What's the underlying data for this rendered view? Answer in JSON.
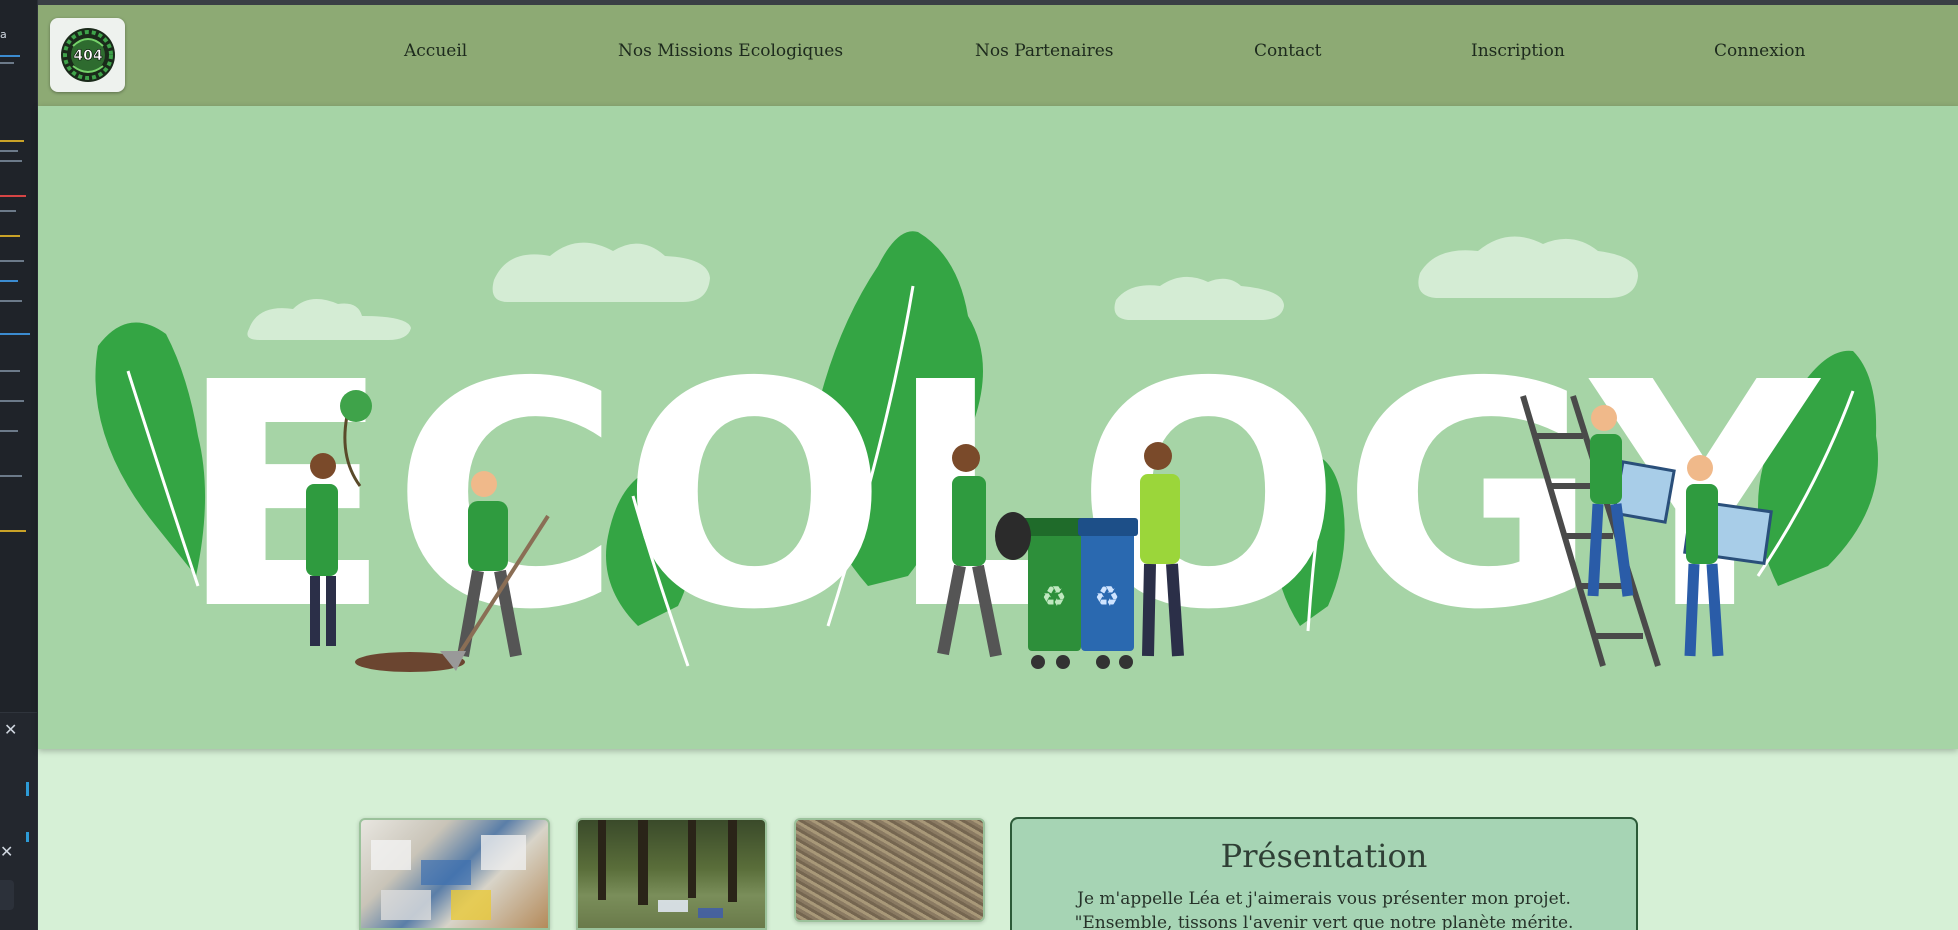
{
  "nav": {
    "logo_text": "404",
    "items": [
      {
        "label": "Accueil"
      },
      {
        "label": "Nos Missions Ecologiques"
      },
      {
        "label": "Nos Partenaires"
      },
      {
        "label": "Contact"
      },
      {
        "label": "Inscription"
      },
      {
        "label": "Connexion"
      }
    ]
  },
  "hero": {
    "word": "ECOLOGY"
  },
  "gallery": {
    "images": [
      {
        "name": "garbage-pile-image"
      },
      {
        "name": "forest-waste-image"
      },
      {
        "name": "cigarette-butts-image"
      }
    ]
  },
  "presentation": {
    "title": "Présentation",
    "line1": "Je m'appelle Léa et j'aimerais vous présenter mon projet.",
    "line2": "\"Ensemble, tissons l'avenir vert que notre planète mérite."
  },
  "colors": {
    "header_bg": "#8daa74",
    "hero_bg": "#a6d4a6",
    "page_bg": "#d6f0d6",
    "leaf_green": "#34a544"
  }
}
